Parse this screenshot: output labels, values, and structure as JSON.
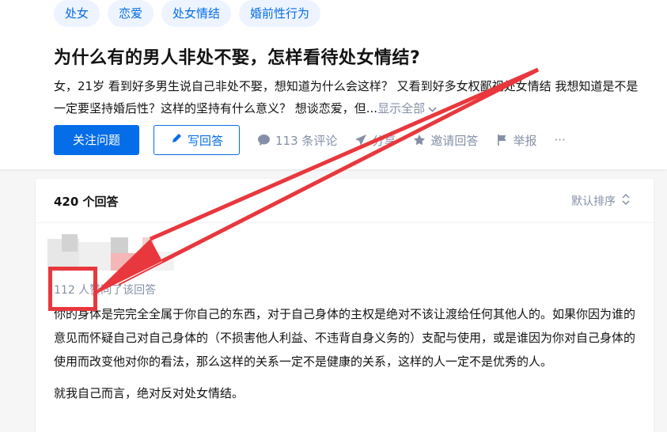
{
  "topics": [
    "处女",
    "恋爱",
    "处女情结",
    "婚前性行为"
  ],
  "question": {
    "title": "为什么有的男人非处不娶，怎样看待处女情结?",
    "detail": "女，21岁 看到好多男生说自己非处不娶，想知道为什么会这样？ 又看到好多女权鄙视处女情结 我想知道是不是一定要坚持婚后性？这样的坚持有什么意义？ 想谈恋爱，但...",
    "show_all": "显示全部"
  },
  "actions": {
    "follow": "关注问题",
    "write": "写回答",
    "comments": "113 条评论",
    "share": "分享",
    "invite": "邀请回答",
    "report": "举报",
    "more": "···"
  },
  "answers": {
    "count": "420 个回答",
    "sort": "默认排序",
    "upvotes": "112 人赞同了该回答",
    "paragraphs": [
      "你的身体是完完全全属于你自己的东西，对于自己身体的主权是绝对不该让渡给任何其他人的。如果你因为谁的意见而怀疑自己对自己身体的（不损害他人利益、不违背自身义务的）支配与使用，或是谁因为你对自己身体的使用而改变他对你的看法，那么这样的关系一定不是健康的关系，这样的人一定不是优秀的人。",
      "就我自己而言，绝对反对处女情结。"
    ]
  },
  "colors": {
    "brand": "#056de8",
    "muted": "#8590a6",
    "annotation": "#e8383d"
  },
  "icons": [
    "pencil-icon",
    "comment-icon",
    "share-icon",
    "invite-icon",
    "flag-icon",
    "sort-icon",
    "chevron-down-icon"
  ]
}
